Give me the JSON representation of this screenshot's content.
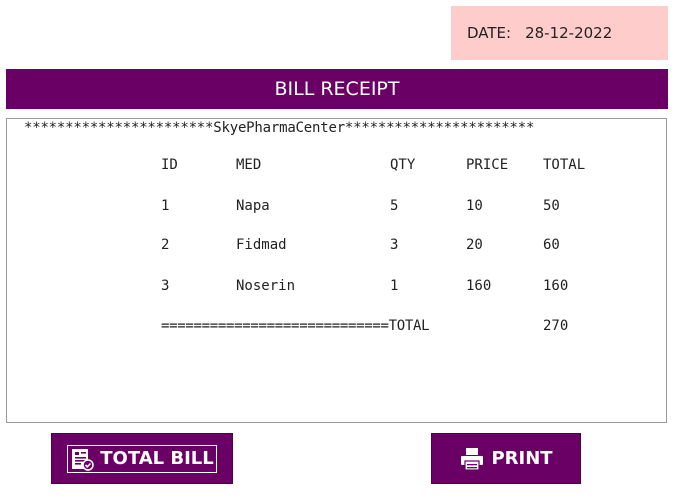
{
  "date": {
    "label": "DATE:",
    "value": "28-12-2022"
  },
  "title": "BILL RECEIPT",
  "receipt": {
    "header": "***********************SkyePharmaCenter***********************",
    "columns": [
      "ID",
      "MED",
      "QTY",
      "PRICE",
      "TOTAL"
    ],
    "rows": [
      [
        "1",
        "Napa",
        "5",
        "10",
        "50"
      ],
      [
        "2",
        "Fidmad",
        "3",
        "20",
        "60"
      ],
      [
        "3",
        "Noserin",
        "1",
        "160",
        "160"
      ]
    ],
    "total_line": "============================TOTAL",
    "total_value": "270"
  },
  "buttons": {
    "total_bill": {
      "label": "TOTAL BILL",
      "icon": "invoice-icon"
    },
    "print": {
      "label": "PRINT",
      "icon": "printer-icon"
    }
  },
  "colors": {
    "accent": "#6a0066",
    "date_background": "#ffcccc"
  }
}
